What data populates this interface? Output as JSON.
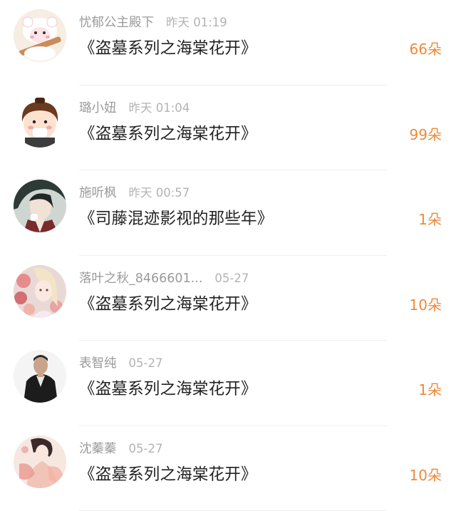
{
  "colors": {
    "accent": "#ee8a3c",
    "name_text": "#9a9a9a",
    "time_text": "#b3b3b3",
    "title_text": "#222222"
  },
  "items": [
    {
      "name": "忧郁公主殿下",
      "time": "昨天 01:19",
      "title": "《盗墓系列之海棠花开》",
      "flowers": "66朵",
      "avatar_icon": "cartoon-sheep-avatar"
    },
    {
      "name": "璐小妞",
      "time": "昨天 01:04",
      "title": "《盗墓系列之海棠花开》",
      "flowers": "99朵",
      "avatar_icon": "cartoon-boy-avatar"
    },
    {
      "name": "施听枫",
      "time": "昨天 00:57",
      "title": "《司藤混迹影视的那些年》",
      "flowers": "1朵",
      "avatar_icon": "anime-man-avatar"
    },
    {
      "name": "落叶之秋_8466601...",
      "time": "05-27",
      "title": "《盗墓系列之海棠花开》",
      "flowers": "10朵",
      "avatar_icon": "floral-girl-avatar"
    },
    {
      "name": "表智纯",
      "time": "05-27",
      "title": "《盗墓系列之海棠花开》",
      "flowers": "1朵",
      "avatar_icon": "man-photo-avatar"
    },
    {
      "name": "沈蓁蓁",
      "time": "05-27",
      "title": "《盗墓系列之海棠花开》",
      "flowers": "10朵",
      "avatar_icon": "ancient-girl-avatar"
    }
  ]
}
